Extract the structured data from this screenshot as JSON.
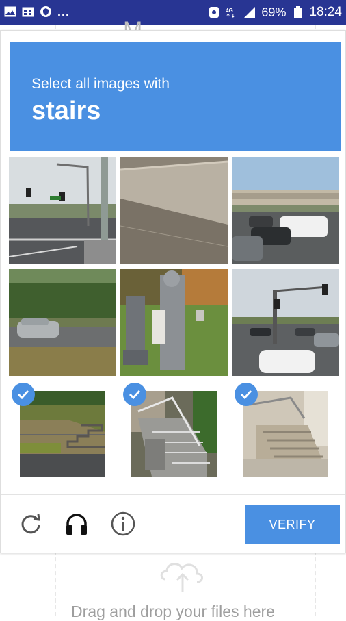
{
  "status_bar": {
    "left_icons": [
      "gallery-icon",
      "calendar-icon",
      "shield-icon"
    ],
    "overflow": "...",
    "right_icons": [
      "alarm-icon",
      "network-4g-icon",
      "signal-icon"
    ],
    "battery": "69%",
    "time": "18:24"
  },
  "background_page": {
    "drop_text": "Drag and drop your files here",
    "top_fragment": "M"
  },
  "captcha": {
    "prompt_prefix": "Select all images with",
    "prompt_target": "stairs",
    "tiles": [
      {
        "scene": "road-with-traffic-light",
        "selected": false
      },
      {
        "scene": "concrete-wall",
        "selected": false
      },
      {
        "scene": "parking-lot-overpass",
        "selected": false
      },
      {
        "scene": "road-with-car",
        "selected": false
      },
      {
        "scene": "cemetery-statues",
        "selected": false
      },
      {
        "scene": "intersection-cars",
        "selected": false
      },
      {
        "scene": "garden-steps",
        "selected": true
      },
      {
        "scene": "stairs-with-railing",
        "selected": true
      },
      {
        "scene": "stone-stairs",
        "selected": true
      }
    ],
    "footer": {
      "reload_icon": "reload-icon",
      "audio_icon": "headphones-icon",
      "info_icon": "info-icon",
      "verify_label": "VERIFY"
    }
  }
}
